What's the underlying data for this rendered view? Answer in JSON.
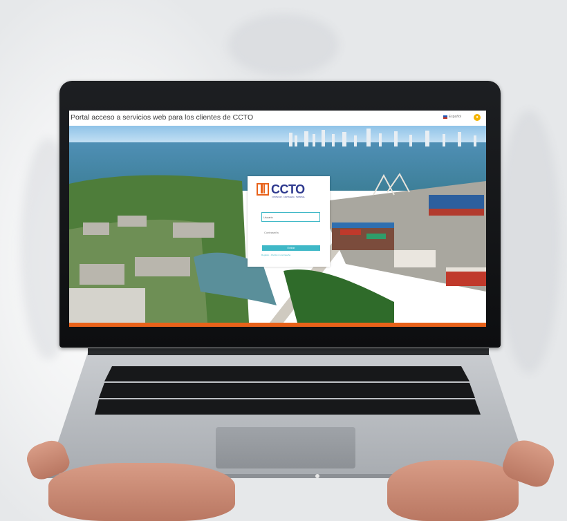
{
  "browser": {
    "page_title": "Portal acceso a servicios web para los clientes de CCTO",
    "language_label": "Español",
    "user_icon_glyph": "●"
  },
  "login": {
    "logo_text": "CCTO",
    "logo_subtitle": "CONTECAR · CARTAGENA · TERMINAL",
    "username_placeholder": "Usuario",
    "password_placeholder": "Contraseña",
    "submit_label": "Entrar",
    "links_text": "Registro  •  Olvidé mi contraseña"
  },
  "colors": {
    "accent_teal": "#3fb8c7",
    "brand_orange": "#e8621a",
    "brand_blue": "#2f3a8f"
  }
}
